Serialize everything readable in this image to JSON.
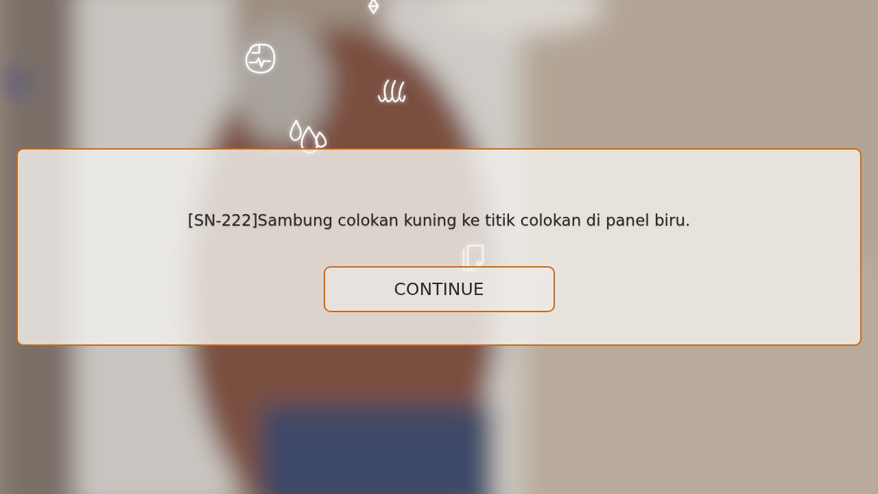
{
  "dialog": {
    "message": "[SN-222]Sambung colokan kuning ke titik colokan di panel biru.",
    "button": "CONTINUE"
  }
}
